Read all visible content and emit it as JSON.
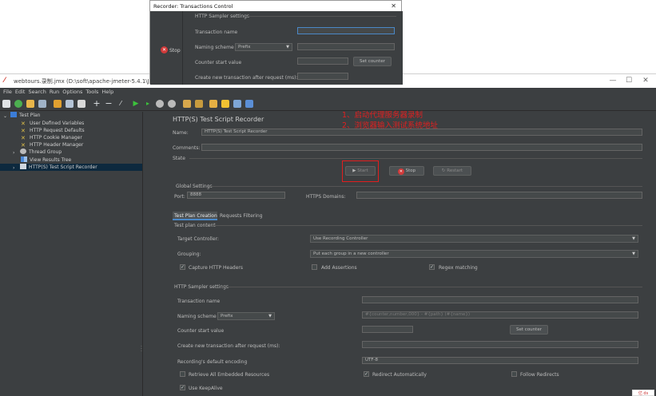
{
  "window": {
    "title": "webtours.录制.jmx (D:\\soft\\apache-jmeter-5.4.1\\Jmeter",
    "minimize": "—",
    "maximize": "☐",
    "close": "✕"
  },
  "menu": [
    "File",
    "Edit",
    "Search",
    "Run",
    "Options",
    "Tools",
    "Help"
  ],
  "tree": {
    "items": [
      {
        "label": "Test Plan",
        "icon": "test-plan-icon"
      },
      {
        "label": "User Defined Variables",
        "icon": "wrench-icon"
      },
      {
        "label": "HTTP Request Defaults",
        "icon": "wrench-icon"
      },
      {
        "label": "HTTP Cookie Manager",
        "icon": "wrench-icon"
      },
      {
        "label": "HTTP Header Manager",
        "icon": "wrench-icon"
      },
      {
        "label": "Thread Group",
        "icon": "gear-icon"
      },
      {
        "label": "View Results Tree",
        "icon": "chart-icon"
      },
      {
        "label": "HTTP(S) Test Script Recorder",
        "icon": "recorder-icon"
      }
    ]
  },
  "recorder": {
    "heading": "HTTP(S) Test Script Recorder",
    "name_label": "Name:",
    "name_value": "HTTP(S) Test Script Recorder",
    "comments_label": "Comments:",
    "comments_value": "",
    "state_label": "State",
    "start_label": "Start",
    "stop_label": "Stop",
    "restart_label": "Restart",
    "global_settings_label": "Global Settings",
    "port_label": "Port:",
    "port_value": "8888",
    "https_domains_label": "HTTPS Domains:",
    "https_domains_value": "",
    "tabs": [
      "Test Plan Creation",
      "Requests Filtering"
    ],
    "test_plan_content_label": "Test plan content",
    "target_controller_label": "Target Controller:",
    "target_controller_value": "Use Recording Controller",
    "grouping_label": "Grouping:",
    "grouping_value": "Put each group in a new controller",
    "capture_headers_label": "Capture HTTP Headers",
    "add_assertions_label": "Add Assertions",
    "regex_matching_label": "Regex matching",
    "sampler_settings_label": "HTTP Sampler settings",
    "transaction_name_label": "Transaction name",
    "transaction_name_value": "",
    "naming_scheme_label": "Naming scheme",
    "naming_scheme_value": "Prefix",
    "naming_pattern_placeholder": "#{counter,number,000} - #{path} (#{name})",
    "counter_start_label": "Counter start value",
    "counter_start_value": "",
    "set_counter_label": "Set counter",
    "create_new_tx_label": "Create new transaction after request (ms):",
    "create_new_tx_value": "",
    "encoding_label": "Recording's default encoding",
    "encoding_value": "UTF-8",
    "retrieve_embedded_label": "Retrieve All Embedded Resources",
    "redirect_auto_label": "Redirect Automatically",
    "follow_redirects_label": "Follow Redirects",
    "keepalive_label": "Use KeepAlive"
  },
  "popup": {
    "title": "Recorder: Transactions Control",
    "close": "✕",
    "stop_label": "Stop",
    "section_label": "HTTP Sampler settings",
    "transaction_name_label": "Transaction name",
    "transaction_name_value": "",
    "naming_scheme_label": "Naming scheme",
    "naming_scheme_value": "Prefix",
    "counter_start_label": "Counter start value",
    "counter_start_value": "",
    "set_counter_label": "Set counter",
    "create_new_tx_label": "Create new transaction after request (ms):",
    "create_new_tx_value": ""
  },
  "annotations": {
    "line1": "1、启动代理服务器录制",
    "line2": "2、浏览器输入测试系统地址"
  },
  "corner_logo": "亿 ds"
}
